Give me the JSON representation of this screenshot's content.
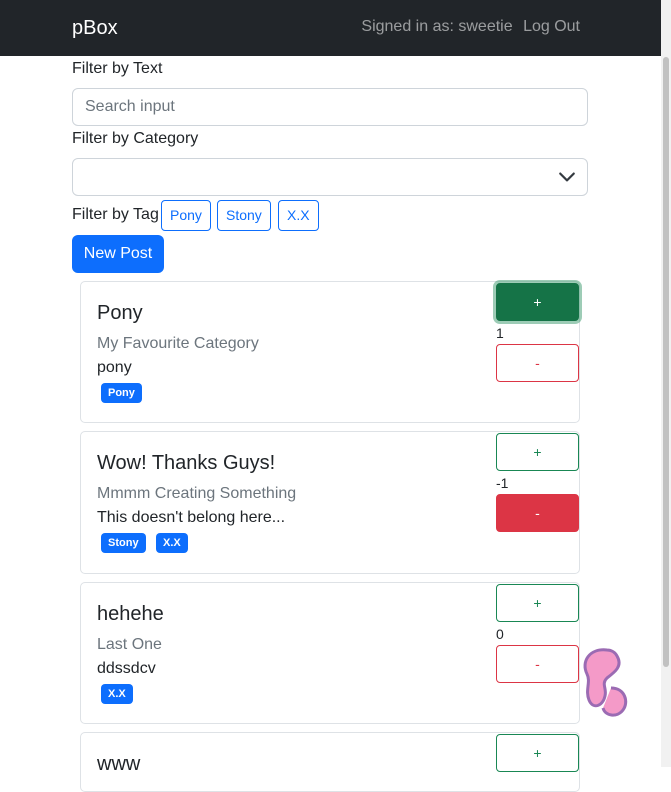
{
  "navbar": {
    "brand": "pBox",
    "signed_in": "Signed in as: sweetie",
    "logout": "Log Out"
  },
  "filters": {
    "text_label": "Filter by Text",
    "search_placeholder": "Search input",
    "category_label": "Filter by Category",
    "category_value": "",
    "tag_label": "Filter by Tag",
    "tags": [
      "Pony",
      "Stony",
      "X.X"
    ],
    "new_post": "New Post"
  },
  "posts": [
    {
      "title": "Pony",
      "category": "My Favourite Category",
      "text": "pony",
      "tags": [
        "Pony"
      ],
      "score": "1",
      "up": "+",
      "down": "-",
      "vote": "up"
    },
    {
      "title": "Wow! Thanks Guys!",
      "category": "Mmmm Creating Something",
      "text": "This doesn't belong here...",
      "tags": [
        "Stony",
        "X.X"
      ],
      "score": "-1",
      "up": "+",
      "down": "-",
      "vote": "down"
    },
    {
      "title": "hehehe",
      "category": "Last One",
      "text": "ddssdcv",
      "tags": [
        "X.X"
      ],
      "score": "0",
      "up": "+",
      "down": "-",
      "vote": "none"
    },
    {
      "title": "www",
      "category": "",
      "text": "",
      "tags": [],
      "score": "",
      "up": "+",
      "down": "-",
      "vote": "none"
    }
  ],
  "colors": {
    "navbar": "#212529",
    "primary": "#0d6efd",
    "success": "#198754",
    "danger": "#dc3545"
  }
}
